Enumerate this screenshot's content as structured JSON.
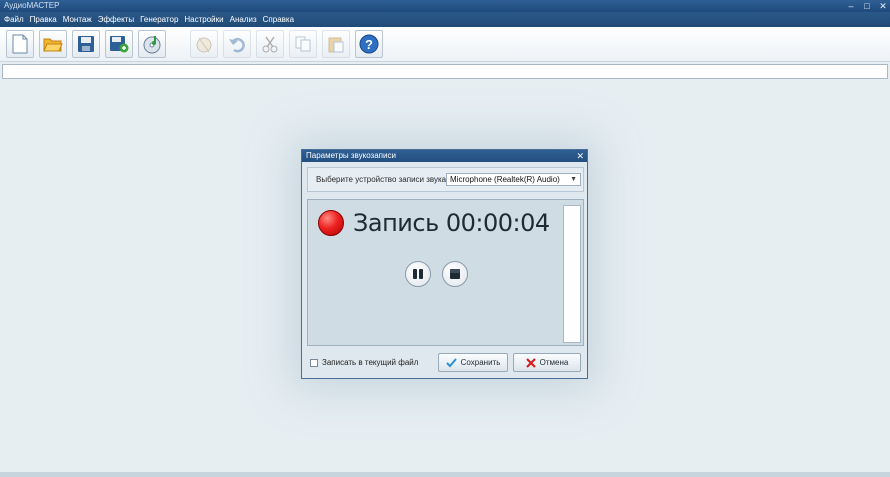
{
  "window": {
    "title": "АудиоМАСТЕР",
    "controls": [
      "–",
      "□",
      "✕"
    ]
  },
  "menu": [
    "Файл",
    "Правка",
    "Монтаж",
    "Эффекты",
    "Генератор",
    "Настройки",
    "Анализ",
    "Справка"
  ],
  "toolbar": {
    "buttons": [
      {
        "icon": "new-file-icon",
        "enabled": true
      },
      {
        "icon": "open-folder-icon",
        "enabled": true
      },
      {
        "icon": "save-icon",
        "enabled": true
      },
      {
        "icon": "save-as-icon",
        "enabled": true
      },
      {
        "icon": "record-cd-icon",
        "enabled": true
      },
      {
        "icon": "burn-icon",
        "enabled": false
      },
      {
        "icon": "undo-icon",
        "enabled": false
      },
      {
        "icon": "cut-icon",
        "enabled": false
      },
      {
        "icon": "copy-icon",
        "enabled": false
      },
      {
        "icon": "paste-icon",
        "enabled": false
      },
      {
        "icon": "help-icon",
        "enabled": true
      }
    ]
  },
  "dialog": {
    "title": "Параметры звукозаписи",
    "close": "✕",
    "device_label": "Выберите устройство записи звука:",
    "device_value": "Microphone (Realtek(R) Audio)",
    "record_status": "Запись 00:00:04",
    "pause_icon": "pause-icon",
    "stop_icon": "stop-icon",
    "checkbox_label": "Записать в текущий файл",
    "checkbox_checked": false,
    "save_label": "Сохранить",
    "cancel_label": "Отмена"
  },
  "colors": {
    "titlebar": "#2f5f94",
    "record": "#ee2222",
    "background": "#e6eef2"
  }
}
